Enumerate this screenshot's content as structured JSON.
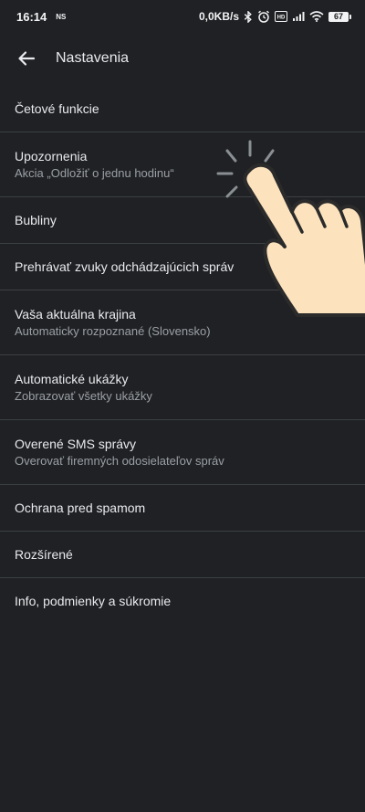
{
  "status_bar": {
    "time": "16:14",
    "indicator": "NS",
    "network_speed": "0,0KB/s",
    "volte": "VoLTE",
    "battery": "67",
    "icons": [
      "bluetooth-icon",
      "alarm-icon",
      "volte-icon",
      "signal-icon",
      "wifi-icon",
      "battery-icon"
    ]
  },
  "app_bar": {
    "back_icon": "arrow-back-icon",
    "title": "Nastavenia"
  },
  "settings": [
    {
      "label": "Četové funkcie"
    },
    {
      "label": "Upozornenia",
      "sublabel": "Akcia „Odložiť o jednu hodinu“"
    },
    {
      "label": "Bubliny"
    },
    {
      "label": "Prehrávať zvuky odchádzajúcich správ"
    },
    {
      "label": "Vaša aktuálna krajina",
      "sublabel": "Automaticky rozpoznané (Slovensko)"
    },
    {
      "label": "Automatické ukážky",
      "sublabel": "Zobrazovať všetky ukážky"
    },
    {
      "label": "Overené SMS správy",
      "sublabel": "Overovať firemných odosielateľov správ"
    },
    {
      "label": "Ochrana pred spamom"
    },
    {
      "label": "Rozšírené"
    },
    {
      "label": "Info, podmienky a súkromie"
    }
  ],
  "overlay": {
    "icon": "tap-hand-icon",
    "target": "Upozornenia"
  },
  "colors": {
    "background": "#202124",
    "text_primary": "#e8eaed",
    "text_secondary": "#9aa0a6",
    "divider": "#3c4043",
    "hand_fill": "#fde3bd",
    "hand_outline": "#2b2b2b"
  }
}
